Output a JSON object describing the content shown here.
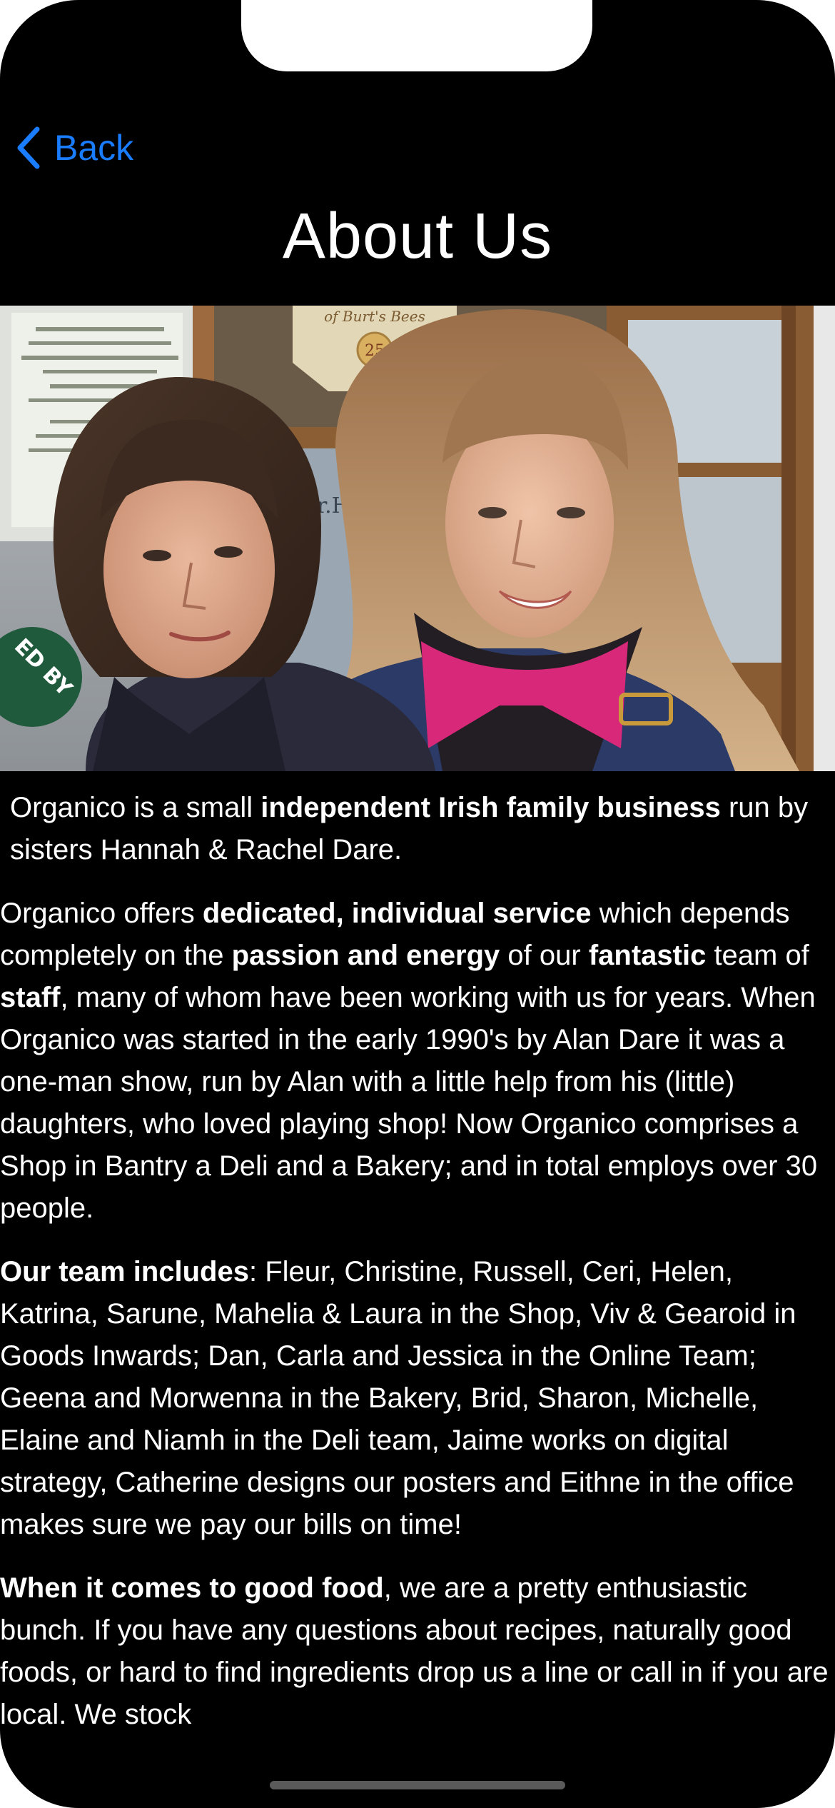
{
  "nav": {
    "back_label": "Back",
    "title": "About Us"
  },
  "hero": {
    "alt": "Photo of sisters Hannah and Rachel Dare outside the shop",
    "sign_text": "of Burt's Bees",
    "badge_text": "25",
    "window_text": "Dr.Hauschka",
    "sticker_text": "ED BY"
  },
  "intro": {
    "t1": "Organico is a small ",
    "b1": "independent Irish family business",
    "t2": " run by sisters Hannah & Rachel Dare."
  },
  "p1": {
    "t1": "Organico offers ",
    "b1": "dedicated, individual service",
    "t2": " which depends completely on the ",
    "b2": "passion and energy",
    "t3": " of our ",
    "b3": "fantastic",
    "t4": " team of ",
    "b4": "staff",
    "t5": ", many of whom have been working with us for years. When Organico was started in the early 1990's by Alan Dare it was a one-man show, run by Alan with a little help from his (little) daughters, who loved playing shop! Now Organico comprises a Shop in Bantry a Deli and a Bakery; and in total employs over 30 people."
  },
  "p2": {
    "b1": "Our team includes",
    "t1": ": Fleur, Christine, Russell, Ceri, Helen, Katrina, Sarune, Mahelia & Laura in the Shop, Viv & Gearoid in Goods Inwards; Dan, Carla and Jessica in the Online Team; Geena and Morwenna in the Bakery, Brid, Sharon, Michelle, Elaine and Niamh in the Deli team, Jaime works on digital strategy, Catherine designs our posters and Eithne in the office makes sure we pay our bills on time!"
  },
  "p3": {
    "b1": "When it comes to good food",
    "t1": ", we are a pretty enthusiastic bunch. If you have any questions about recipes, naturally good foods, or hard to find ingredients drop us a line or call in if you are local. We stock"
  },
  "colors": {
    "background": "#000000",
    "text": "#ffffff",
    "accent": "#1a7cff"
  },
  "icons": {
    "back": "chevron-left-icon"
  }
}
